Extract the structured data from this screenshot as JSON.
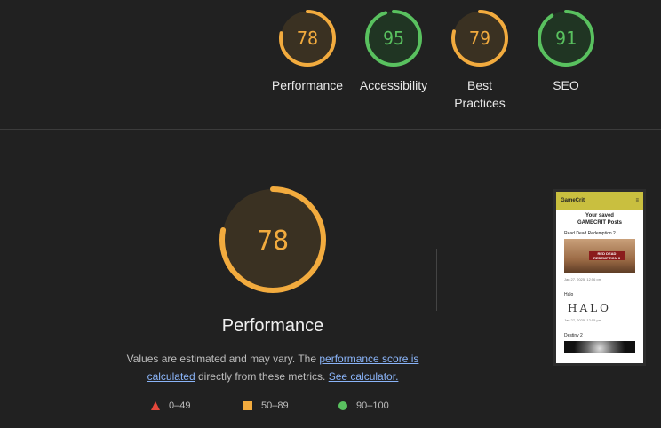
{
  "colors": {
    "orange": "#f2ab3e",
    "green": "#59c15f",
    "red": "#e5483b",
    "bg": "#212121"
  },
  "summary": [
    {
      "label": "Performance",
      "score": 78,
      "level": "average"
    },
    {
      "label": "Accessibility",
      "score": 95,
      "level": "pass"
    },
    {
      "label": "Best Practices",
      "score": 79,
      "level": "average"
    },
    {
      "label": "SEO",
      "score": 91,
      "level": "pass"
    }
  ],
  "main": {
    "score": 78,
    "title": "Performance",
    "desc_prefix": "Values are estimated and may vary. The ",
    "link_score": "performance score is calculated",
    "desc_middle": " directly from these metrics. ",
    "link_calc": "See calculator."
  },
  "legend": {
    "fail": "0–49",
    "average": "50–89",
    "pass": "90–100"
  },
  "thumbnail": {
    "logo": "GameCrit",
    "heading_line1": "Your saved",
    "heading_line2": "GAMECRIT Posts",
    "items": [
      {
        "title": "Read Dead Redemption 2",
        "date": "Jan 27, 2025, 12:56 pm",
        "img_text": "RED DEAD REDEMPTION II"
      },
      {
        "title": "Halo",
        "date": "Jan 27, 2025, 12:55 pm",
        "img_text": "HALO"
      },
      {
        "title": "Destiny 2",
        "date": "",
        "img_text": ""
      }
    ]
  }
}
